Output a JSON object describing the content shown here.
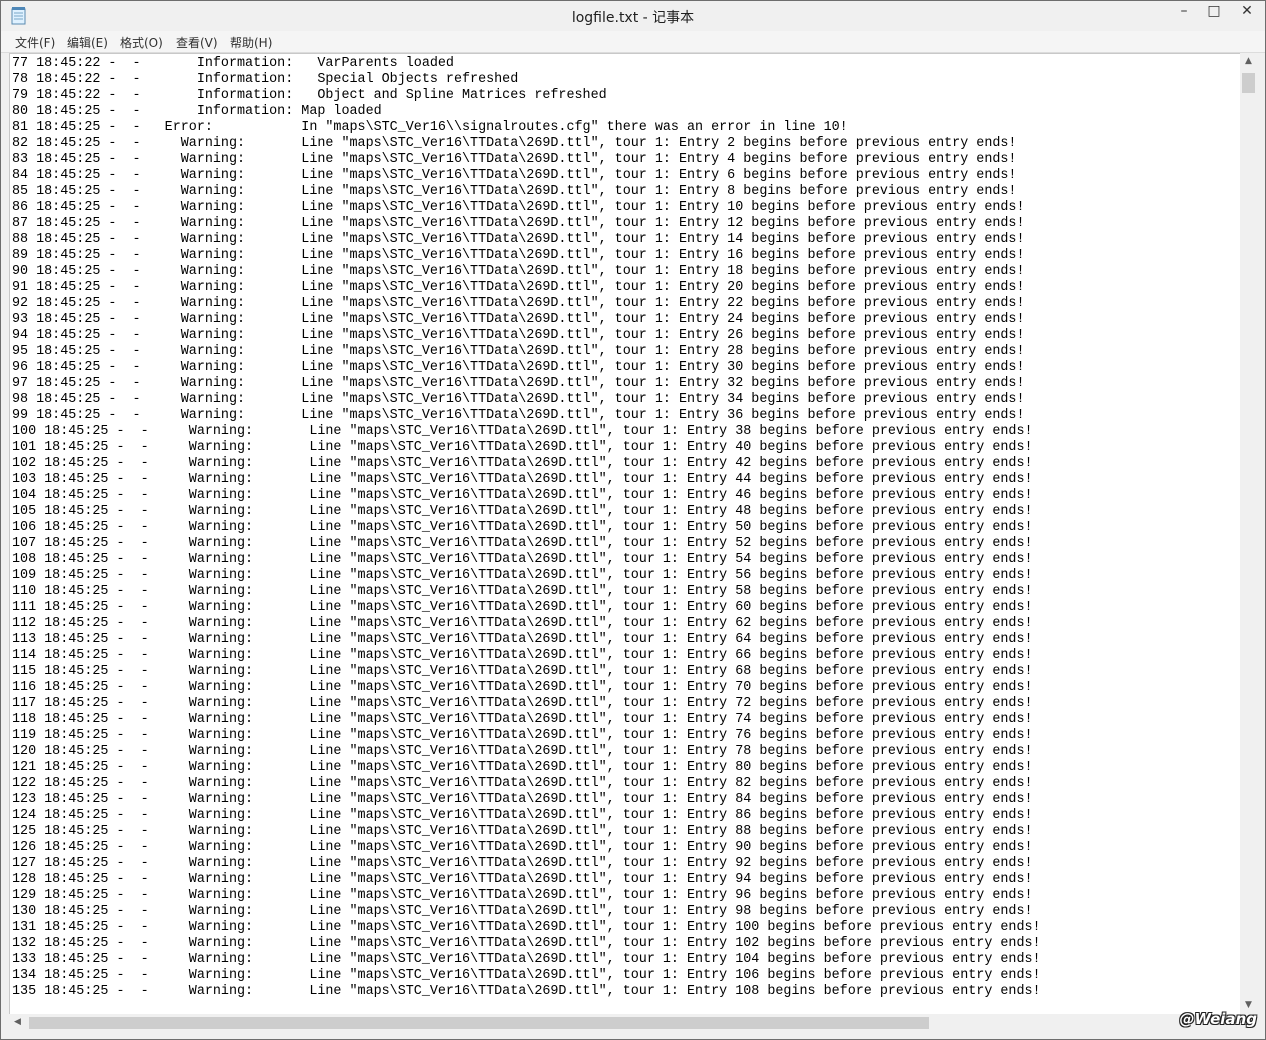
{
  "window": {
    "title": "logfile.txt - 记事本",
    "buttons": {
      "minimize": "–",
      "maximize": "□",
      "close": "✕"
    },
    "icon": "notepad-icon"
  },
  "menu": [
    "文件(F)",
    "编辑(E)",
    "格式(O)",
    "查看(V)",
    "帮助(H)"
  ],
  "content": {
    "lines": [
      "77 18:45:22 -  -       Information:   VarParents loaded",
      "78 18:45:22 -  -       Information:   Special Objects refreshed",
      "79 18:45:22 -  -       Information:   Object and Spline Matrices refreshed",
      "80 18:45:25 -  -       Information: Map loaded",
      "81 18:45:25 -  -   Error:           In \"maps\\STC_Ver16\\\\signalroutes.cfg\" there was an error in line 10!",
      "82 18:45:25 -  -     Warning:       Line \"maps\\STC_Ver16\\TTData\\269D.ttl\", tour 1: Entry 2 begins before previous entry ends!",
      "83 18:45:25 -  -     Warning:       Line \"maps\\STC_Ver16\\TTData\\269D.ttl\", tour 1: Entry 4 begins before previous entry ends!",
      "84 18:45:25 -  -     Warning:       Line \"maps\\STC_Ver16\\TTData\\269D.ttl\", tour 1: Entry 6 begins before previous entry ends!",
      "85 18:45:25 -  -     Warning:       Line \"maps\\STC_Ver16\\TTData\\269D.ttl\", tour 1: Entry 8 begins before previous entry ends!",
      "86 18:45:25 -  -     Warning:       Line \"maps\\STC_Ver16\\TTData\\269D.ttl\", tour 1: Entry 10 begins before previous entry ends!",
      "87 18:45:25 -  -     Warning:       Line \"maps\\STC_Ver16\\TTData\\269D.ttl\", tour 1: Entry 12 begins before previous entry ends!",
      "88 18:45:25 -  -     Warning:       Line \"maps\\STC_Ver16\\TTData\\269D.ttl\", tour 1: Entry 14 begins before previous entry ends!",
      "89 18:45:25 -  -     Warning:       Line \"maps\\STC_Ver16\\TTData\\269D.ttl\", tour 1: Entry 16 begins before previous entry ends!",
      "90 18:45:25 -  -     Warning:       Line \"maps\\STC_Ver16\\TTData\\269D.ttl\", tour 1: Entry 18 begins before previous entry ends!",
      "91 18:45:25 -  -     Warning:       Line \"maps\\STC_Ver16\\TTData\\269D.ttl\", tour 1: Entry 20 begins before previous entry ends!",
      "92 18:45:25 -  -     Warning:       Line \"maps\\STC_Ver16\\TTData\\269D.ttl\", tour 1: Entry 22 begins before previous entry ends!",
      "93 18:45:25 -  -     Warning:       Line \"maps\\STC_Ver16\\TTData\\269D.ttl\", tour 1: Entry 24 begins before previous entry ends!",
      "94 18:45:25 -  -     Warning:       Line \"maps\\STC_Ver16\\TTData\\269D.ttl\", tour 1: Entry 26 begins before previous entry ends!",
      "95 18:45:25 -  -     Warning:       Line \"maps\\STC_Ver16\\TTData\\269D.ttl\", tour 1: Entry 28 begins before previous entry ends!",
      "96 18:45:25 -  -     Warning:       Line \"maps\\STC_Ver16\\TTData\\269D.ttl\", tour 1: Entry 30 begins before previous entry ends!",
      "97 18:45:25 -  -     Warning:       Line \"maps\\STC_Ver16\\TTData\\269D.ttl\", tour 1: Entry 32 begins before previous entry ends!",
      "98 18:45:25 -  -     Warning:       Line \"maps\\STC_Ver16\\TTData\\269D.ttl\", tour 1: Entry 34 begins before previous entry ends!",
      "99 18:45:25 -  -     Warning:       Line \"maps\\STC_Ver16\\TTData\\269D.ttl\", tour 1: Entry 36 begins before previous entry ends!",
      "100 18:45:25 -  -     Warning:       Line \"maps\\STC_Ver16\\TTData\\269D.ttl\", tour 1: Entry 38 begins before previous entry ends!",
      "101 18:45:25 -  -     Warning:       Line \"maps\\STC_Ver16\\TTData\\269D.ttl\", tour 1: Entry 40 begins before previous entry ends!",
      "102 18:45:25 -  -     Warning:       Line \"maps\\STC_Ver16\\TTData\\269D.ttl\", tour 1: Entry 42 begins before previous entry ends!",
      "103 18:45:25 -  -     Warning:       Line \"maps\\STC_Ver16\\TTData\\269D.ttl\", tour 1: Entry 44 begins before previous entry ends!",
      "104 18:45:25 -  -     Warning:       Line \"maps\\STC_Ver16\\TTData\\269D.ttl\", tour 1: Entry 46 begins before previous entry ends!",
      "105 18:45:25 -  -     Warning:       Line \"maps\\STC_Ver16\\TTData\\269D.ttl\", tour 1: Entry 48 begins before previous entry ends!",
      "106 18:45:25 -  -     Warning:       Line \"maps\\STC_Ver16\\TTData\\269D.ttl\", tour 1: Entry 50 begins before previous entry ends!",
      "107 18:45:25 -  -     Warning:       Line \"maps\\STC_Ver16\\TTData\\269D.ttl\", tour 1: Entry 52 begins before previous entry ends!",
      "108 18:45:25 -  -     Warning:       Line \"maps\\STC_Ver16\\TTData\\269D.ttl\", tour 1: Entry 54 begins before previous entry ends!",
      "109 18:45:25 -  -     Warning:       Line \"maps\\STC_Ver16\\TTData\\269D.ttl\", tour 1: Entry 56 begins before previous entry ends!",
      "110 18:45:25 -  -     Warning:       Line \"maps\\STC_Ver16\\TTData\\269D.ttl\", tour 1: Entry 58 begins before previous entry ends!",
      "111 18:45:25 -  -     Warning:       Line \"maps\\STC_Ver16\\TTData\\269D.ttl\", tour 1: Entry 60 begins before previous entry ends!",
      "112 18:45:25 -  -     Warning:       Line \"maps\\STC_Ver16\\TTData\\269D.ttl\", tour 1: Entry 62 begins before previous entry ends!",
      "113 18:45:25 -  -     Warning:       Line \"maps\\STC_Ver16\\TTData\\269D.ttl\", tour 1: Entry 64 begins before previous entry ends!",
      "114 18:45:25 -  -     Warning:       Line \"maps\\STC_Ver16\\TTData\\269D.ttl\", tour 1: Entry 66 begins before previous entry ends!",
      "115 18:45:25 -  -     Warning:       Line \"maps\\STC_Ver16\\TTData\\269D.ttl\", tour 1: Entry 68 begins before previous entry ends!",
      "116 18:45:25 -  -     Warning:       Line \"maps\\STC_Ver16\\TTData\\269D.ttl\", tour 1: Entry 70 begins before previous entry ends!",
      "117 18:45:25 -  -     Warning:       Line \"maps\\STC_Ver16\\TTData\\269D.ttl\", tour 1: Entry 72 begins before previous entry ends!",
      "118 18:45:25 -  -     Warning:       Line \"maps\\STC_Ver16\\TTData\\269D.ttl\", tour 1: Entry 74 begins before previous entry ends!",
      "119 18:45:25 -  -     Warning:       Line \"maps\\STC_Ver16\\TTData\\269D.ttl\", tour 1: Entry 76 begins before previous entry ends!",
      "120 18:45:25 -  -     Warning:       Line \"maps\\STC_Ver16\\TTData\\269D.ttl\", tour 1: Entry 78 begins before previous entry ends!",
      "121 18:45:25 -  -     Warning:       Line \"maps\\STC_Ver16\\TTData\\269D.ttl\", tour 1: Entry 80 begins before previous entry ends!",
      "122 18:45:25 -  -     Warning:       Line \"maps\\STC_Ver16\\TTData\\269D.ttl\", tour 1: Entry 82 begins before previous entry ends!",
      "123 18:45:25 -  -     Warning:       Line \"maps\\STC_Ver16\\TTData\\269D.ttl\", tour 1: Entry 84 begins before previous entry ends!",
      "124 18:45:25 -  -     Warning:       Line \"maps\\STC_Ver16\\TTData\\269D.ttl\", tour 1: Entry 86 begins before previous entry ends!",
      "125 18:45:25 -  -     Warning:       Line \"maps\\STC_Ver16\\TTData\\269D.ttl\", tour 1: Entry 88 begins before previous entry ends!",
      "126 18:45:25 -  -     Warning:       Line \"maps\\STC_Ver16\\TTData\\269D.ttl\", tour 1: Entry 90 begins before previous entry ends!",
      "127 18:45:25 -  -     Warning:       Line \"maps\\STC_Ver16\\TTData\\269D.ttl\", tour 1: Entry 92 begins before previous entry ends!",
      "128 18:45:25 -  -     Warning:       Line \"maps\\STC_Ver16\\TTData\\269D.ttl\", tour 1: Entry 94 begins before previous entry ends!",
      "129 18:45:25 -  -     Warning:       Line \"maps\\STC_Ver16\\TTData\\269D.ttl\", tour 1: Entry 96 begins before previous entry ends!",
      "130 18:45:25 -  -     Warning:       Line \"maps\\STC_Ver16\\TTData\\269D.ttl\", tour 1: Entry 98 begins before previous entry ends!",
      "131 18:45:25 -  -     Warning:       Line \"maps\\STC_Ver16\\TTData\\269D.ttl\", tour 1: Entry 100 begins before previous entry ends!",
      "132 18:45:25 -  -     Warning:       Line \"maps\\STC_Ver16\\TTData\\269D.ttl\", tour 1: Entry 102 begins before previous entry ends!",
      "133 18:45:25 -  -     Warning:       Line \"maps\\STC_Ver16\\TTData\\269D.ttl\", tour 1: Entry 104 begins before previous entry ends!",
      "134 18:45:25 -  -     Warning:       Line \"maps\\STC_Ver16\\TTData\\269D.ttl\", tour 1: Entry 106 begins before previous entry ends!",
      "135 18:45:25 -  -     Warning:       Line \"maps\\STC_Ver16\\TTData\\269D.ttl\", tour 1: Entry 108 begins before previous entry ends!"
    ]
  },
  "scrollbars": {
    "vertical": {
      "up_icon": "arrow-up-icon",
      "down_icon": "arrow-down-icon"
    },
    "horizontal": {
      "left_icon": "arrow-left-icon",
      "right_icon": "arrow-right-icon"
    }
  },
  "watermark": "@Weiang"
}
